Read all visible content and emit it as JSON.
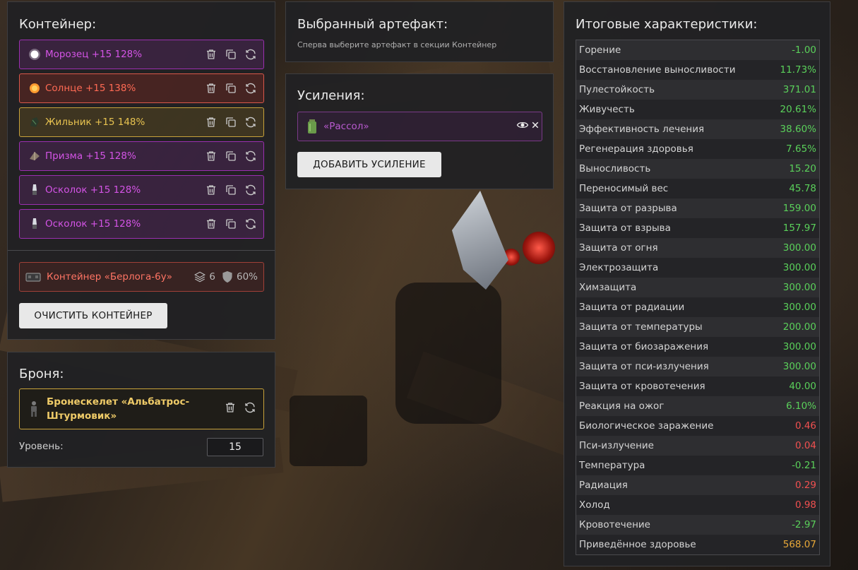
{
  "container": {
    "title": "Контейнер:",
    "artifacts": [
      {
        "name": "Морозец +15 128%",
        "rarity": "purple",
        "icon": "snowball-icon"
      },
      {
        "name": "Солнце +15 138%",
        "rarity": "red",
        "icon": "sun-orb-icon"
      },
      {
        "name": "Жильник +15 148%",
        "rarity": "yellow",
        "icon": "vein-rock-icon"
      },
      {
        "name": "Призма +15 128%",
        "rarity": "purple",
        "icon": "prism-icon"
      },
      {
        "name": "Осколок +15 128%",
        "rarity": "purple",
        "icon": "shard-icon"
      },
      {
        "name": "Осколок +15 128%",
        "rarity": "purple",
        "icon": "shard-icon"
      }
    ],
    "selected_container": {
      "name": "Контейнер «Берлога-6у»",
      "slots": "6",
      "protection": "60%"
    },
    "clear_label": "ОЧИСТИТЬ КОНТЕЙНЕР"
  },
  "armor": {
    "title": "Броня:",
    "name": "Бронескелет «Альбатрос-Штурмовик»",
    "level_label": "Уровень:",
    "level_value": "15"
  },
  "selected": {
    "title": "Выбранный артефакт:",
    "hint": "Сперва выберите артефакт в секции Контейнер"
  },
  "boosts": {
    "title": "Усиления:",
    "items": [
      {
        "name": "«Рассол»"
      }
    ],
    "add_label": "ДОБАВИТЬ УСИЛЕНИЕ"
  },
  "stats": {
    "title": "Итоговые характеристики:",
    "rows": [
      {
        "name": "Горение",
        "value": "-1.00",
        "color": "green"
      },
      {
        "name": "Восстановление выносливости",
        "value": "11.73%",
        "color": "green"
      },
      {
        "name": "Пулестойкость",
        "value": "371.01",
        "color": "green"
      },
      {
        "name": "Живучесть",
        "value": "20.61%",
        "color": "green"
      },
      {
        "name": "Эффективность лечения",
        "value": "38.60%",
        "color": "green"
      },
      {
        "name": "Регенерация здоровья",
        "value": "7.65%",
        "color": "green"
      },
      {
        "name": "Выносливость",
        "value": "15.20",
        "color": "green"
      },
      {
        "name": "Переносимый вес",
        "value": "45.78",
        "color": "green"
      },
      {
        "name": "Защита от разрыва",
        "value": "159.00",
        "color": "green"
      },
      {
        "name": "Защита от взрыва",
        "value": "157.97",
        "color": "green"
      },
      {
        "name": "Защита от огня",
        "value": "300.00",
        "color": "green"
      },
      {
        "name": "Электрозащита",
        "value": "300.00",
        "color": "green"
      },
      {
        "name": "Химзащита",
        "value": "300.00",
        "color": "green"
      },
      {
        "name": "Защита от радиации",
        "value": "300.00",
        "color": "green"
      },
      {
        "name": "Защита от температуры",
        "value": "200.00",
        "color": "green"
      },
      {
        "name": "Защита от биозаражения",
        "value": "300.00",
        "color": "green"
      },
      {
        "name": "Защита от пси-излучения",
        "value": "300.00",
        "color": "green"
      },
      {
        "name": "Защита от кровотечения",
        "value": "40.00",
        "color": "green"
      },
      {
        "name": "Реакция на ожог",
        "value": "6.10%",
        "color": "green"
      },
      {
        "name": "Биологическое заражение",
        "value": "0.46",
        "color": "red"
      },
      {
        "name": "Пси-излучение",
        "value": "0.04",
        "color": "red"
      },
      {
        "name": "Температура",
        "value": "-0.21",
        "color": "green"
      },
      {
        "name": "Радиация",
        "value": "0.29",
        "color": "red"
      },
      {
        "name": "Холод",
        "value": "0.98",
        "color": "red"
      },
      {
        "name": "Кровотечение",
        "value": "-2.97",
        "color": "green"
      },
      {
        "name": "Приведённое здоровье",
        "value": "568.07",
        "color": "gold"
      }
    ]
  },
  "colors": {
    "purple": "#d454e6",
    "red": "#ff6a54",
    "yellow": "#e8c350",
    "positive": "#5ad05a",
    "negative": "#f05050",
    "total": "#e8a838"
  }
}
